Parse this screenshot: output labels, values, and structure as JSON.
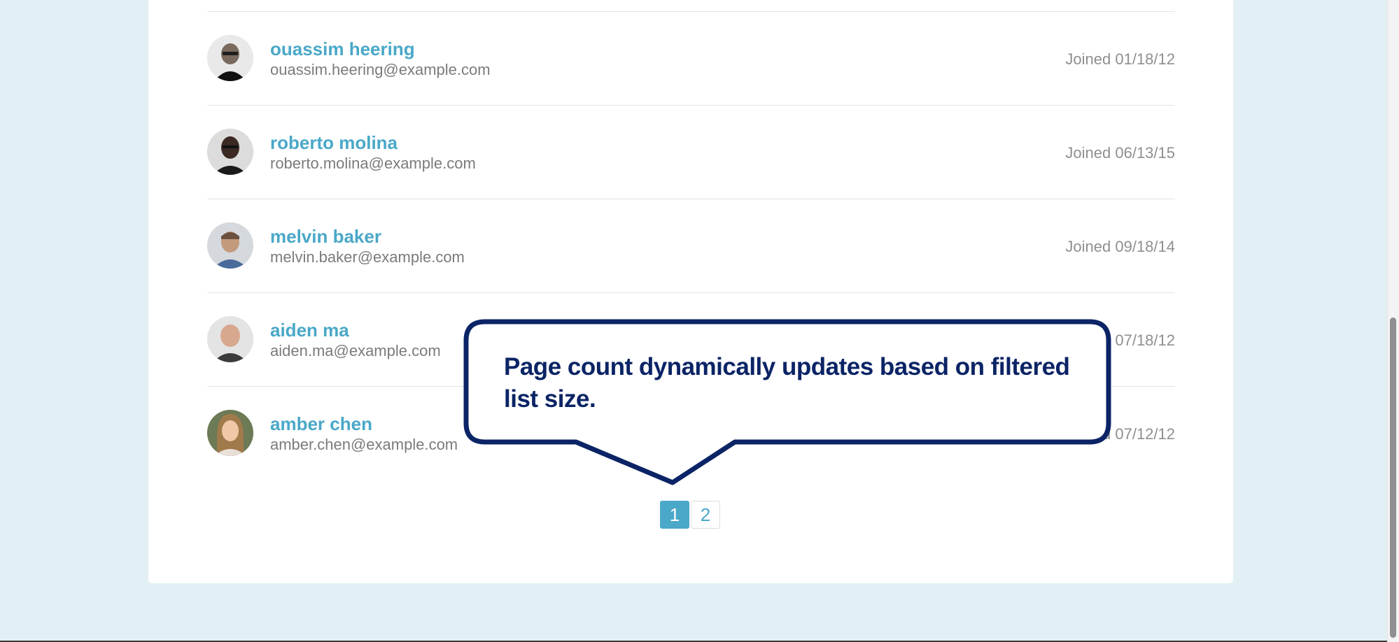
{
  "users": [
    {
      "name": "ouassim heering",
      "email": "ouassim.heering@example.com",
      "joined": "Joined 01/18/12"
    },
    {
      "name": "roberto molina",
      "email": "roberto.molina@example.com",
      "joined": "Joined 06/13/15"
    },
    {
      "name": "melvin baker",
      "email": "melvin.baker@example.com",
      "joined": "Joined 09/18/14"
    },
    {
      "name": "aiden ma",
      "email": "aiden.ma@example.com",
      "joined": "Joined 07/18/12"
    },
    {
      "name": "amber chen",
      "email": "amber.chen@example.com",
      "joined": "Joined 07/12/12"
    }
  ],
  "pagination": {
    "pages": [
      "1",
      "2"
    ],
    "current_page": "1"
  },
  "callout": {
    "text": "Page count dynamically updates based on filtered list size."
  },
  "colors": {
    "background": "#e2f0f5",
    "accent": "#4aa8c8",
    "callout_border": "#0b2466"
  }
}
